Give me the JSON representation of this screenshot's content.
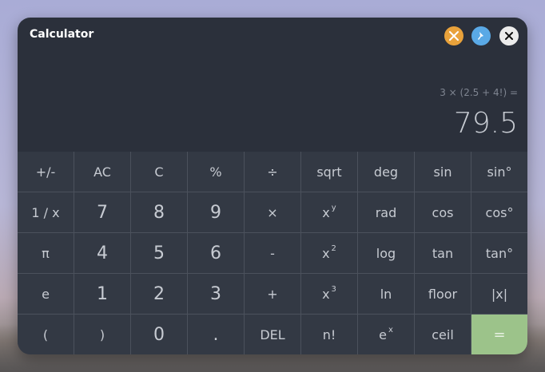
{
  "window": {
    "title": "Calculator",
    "titlebar_buttons": [
      {
        "name": "tools-icon",
        "color": "#e9a23b"
      },
      {
        "name": "pin-icon",
        "color": "#5aa9e6"
      },
      {
        "name": "close-icon",
        "color": "#ececec"
      }
    ]
  },
  "display": {
    "expression": "3 × (2.5 + 4!) =",
    "result": "79.5"
  },
  "keys": {
    "row1": [
      "+/-",
      "AC",
      "C",
      "%",
      "÷",
      "sqrt",
      "deg",
      "sin",
      "sin°"
    ],
    "row2": [
      "1 / x",
      "7",
      "8",
      "9",
      "×",
      "x",
      "rad",
      "cos",
      "cos°"
    ],
    "row2_pow_sup": "y",
    "row3": [
      "π",
      "4",
      "5",
      "6",
      "-",
      "x",
      "log",
      "tan",
      "tan°"
    ],
    "row3_pow_sup": "2",
    "row4": [
      "e",
      "1",
      "2",
      "3",
      "+",
      "x",
      "ln",
      "floor",
      "|x|"
    ],
    "row4_pow_sup": "3",
    "row5": [
      "(",
      ")",
      "0",
      ".",
      "DEL",
      "n!",
      "e",
      "ceil",
      "="
    ],
    "row5_exp_sup": "x"
  },
  "colors": {
    "window_bg": "#2b303b",
    "key_bg": "#333944",
    "equals_bg": "#9cc38a"
  }
}
